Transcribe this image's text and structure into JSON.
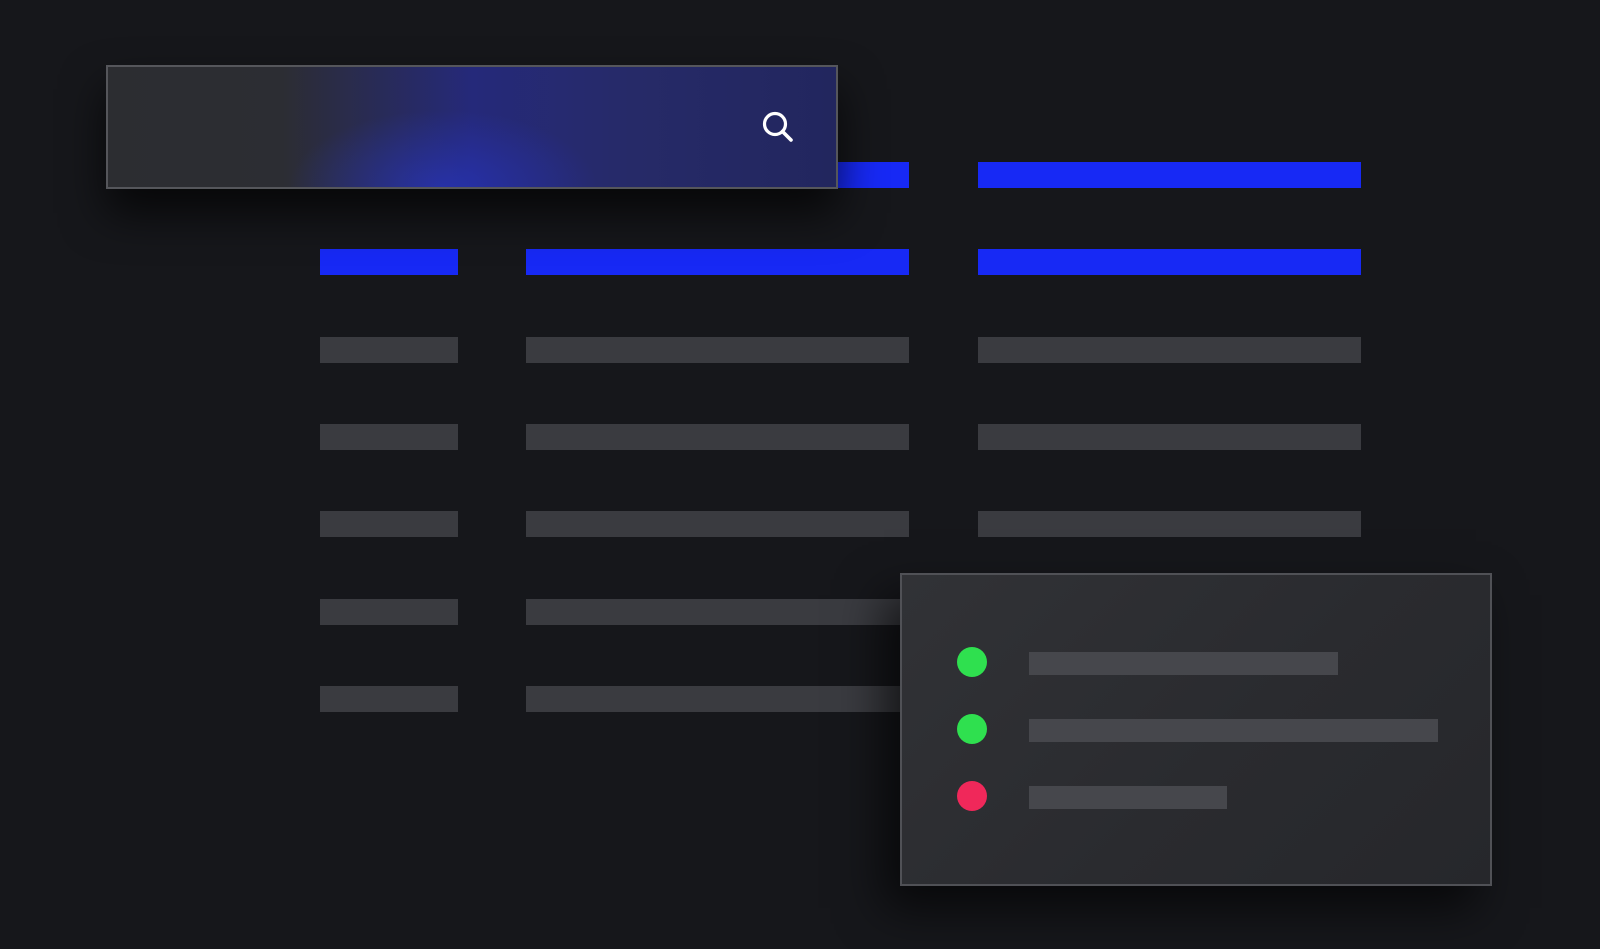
{
  "search": {
    "icon": "search-icon",
    "icon_color": "#ffffff",
    "accent_color": "#1729f5"
  },
  "table": {
    "columns": 3,
    "header_rows": 2,
    "body_rows": 5,
    "highlight_color": "#1729f5",
    "placeholder_color": "#3a3b40"
  },
  "status_panel": {
    "items": [
      {
        "status": "ok",
        "color": "#2fe04f"
      },
      {
        "status": "ok",
        "color": "#2fe04f"
      },
      {
        "status": "error",
        "color": "#f0285a"
      }
    ]
  }
}
